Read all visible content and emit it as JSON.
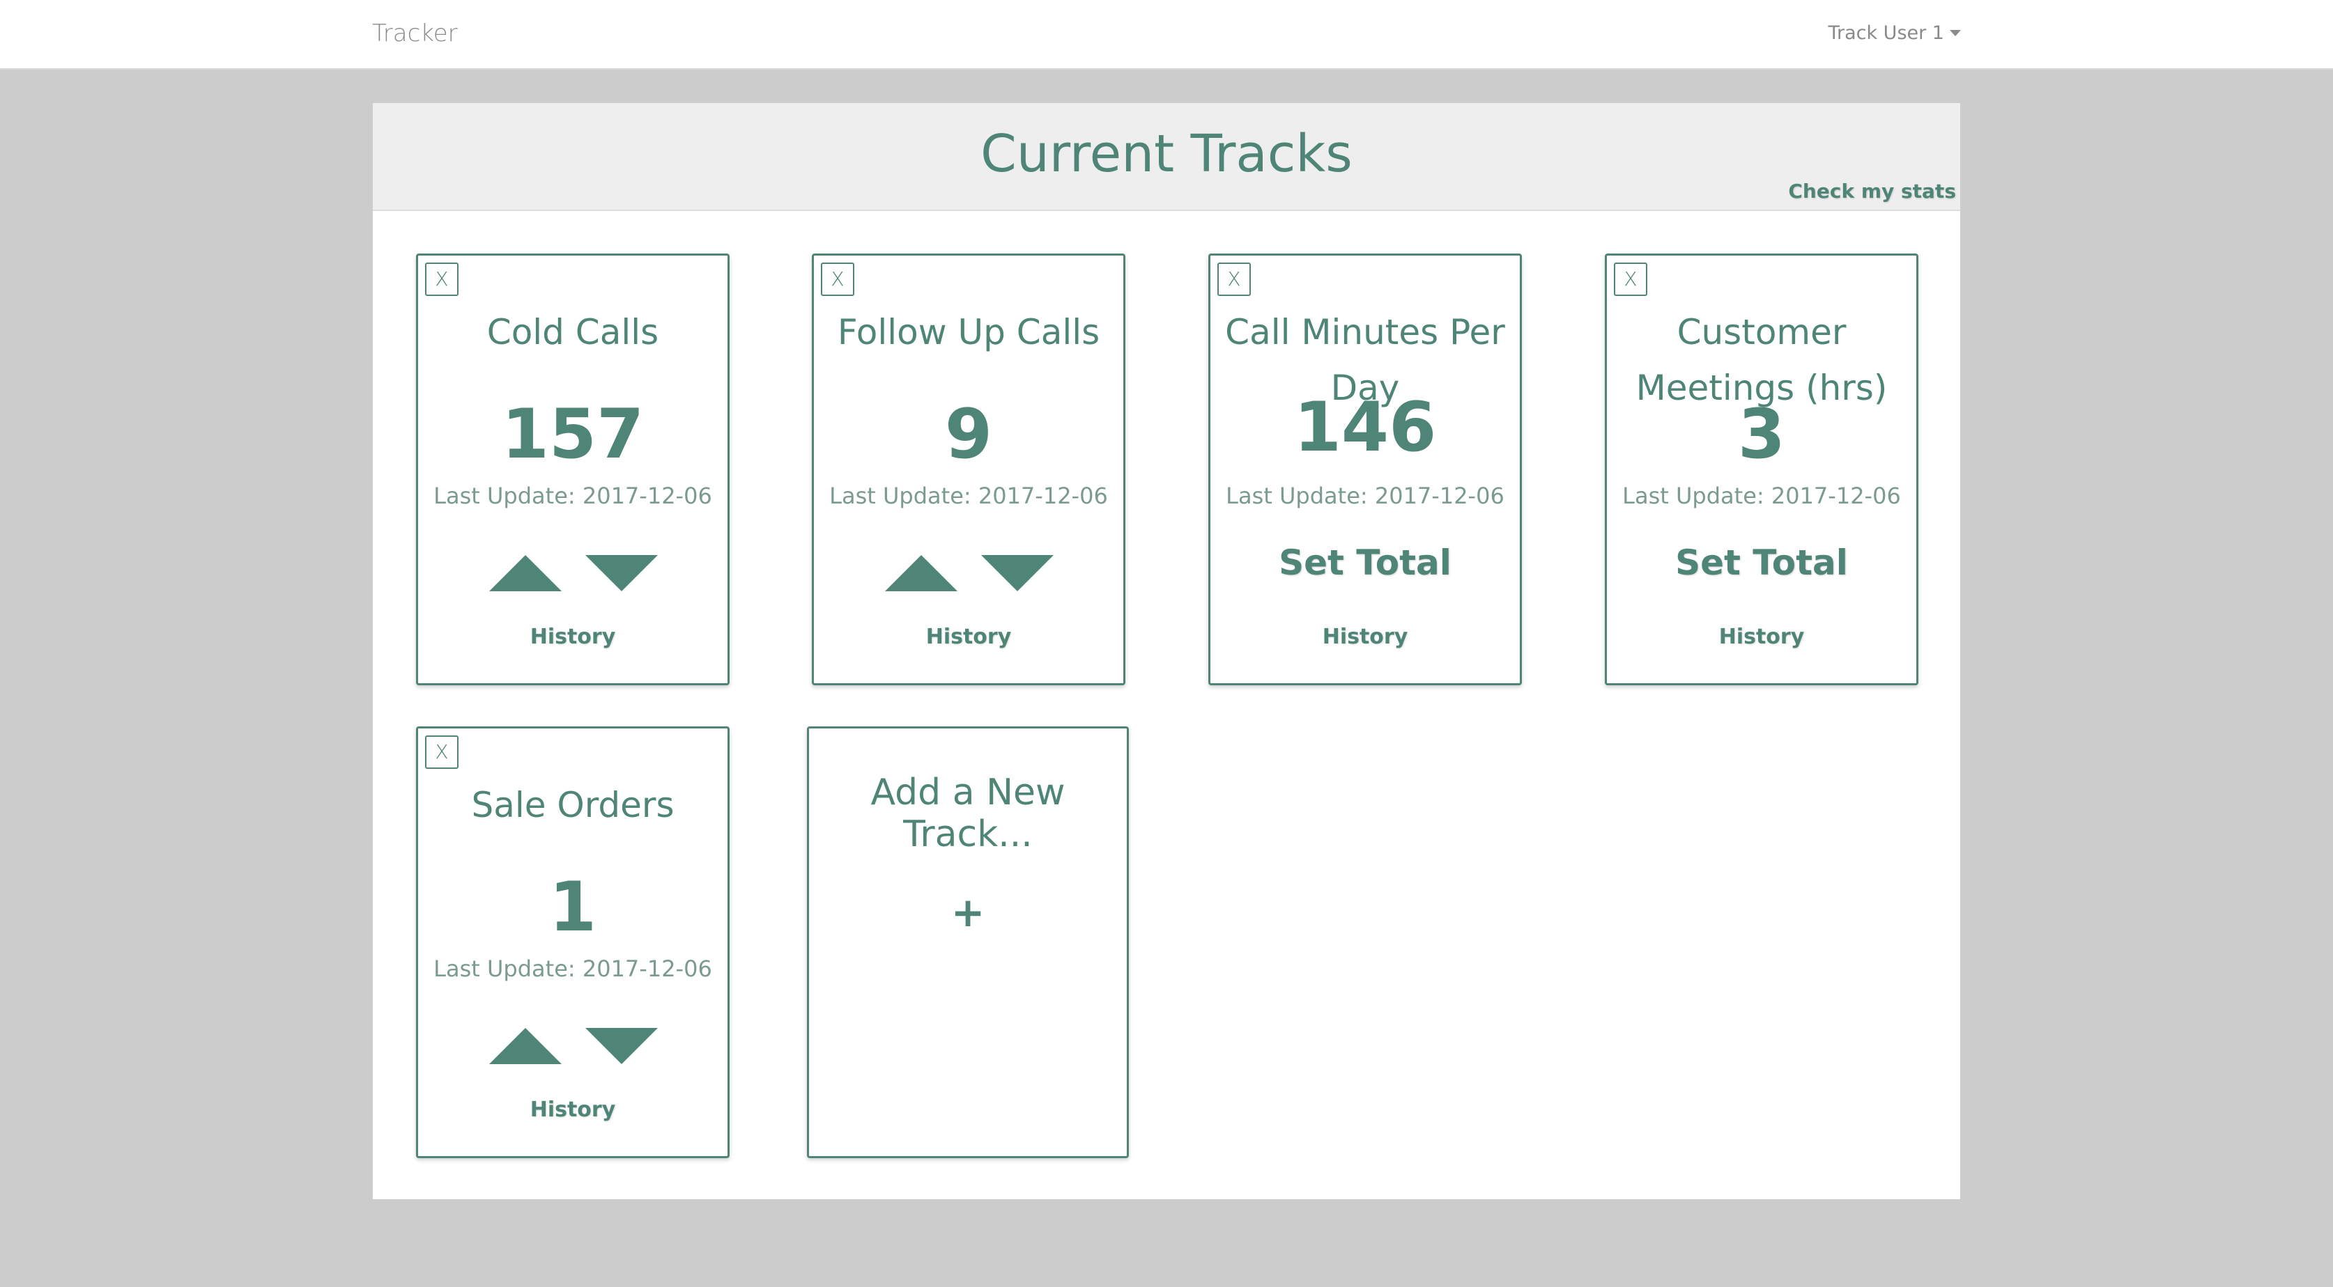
{
  "navbar": {
    "brand": "Tracker",
    "user_menu_label": "Track User 1"
  },
  "panel": {
    "title": "Current Tracks",
    "stats_link": "Check my stats"
  },
  "cards": [
    {
      "close": "X",
      "title": "Cold Calls",
      "value": "157",
      "last_update": "Last Update: 2017-12-06",
      "history": "History"
    },
    {
      "close": "X",
      "title": "Follow Up Calls",
      "value": "9",
      "last_update": "Last Update: 2017-12-06",
      "history": "History"
    },
    {
      "close": "X",
      "title": "Call Minutes Per Day",
      "value": "146",
      "last_update": "Last Update: 2017-12-06",
      "set_total": "Set Total",
      "history": "History"
    },
    {
      "close": "X",
      "title": "Customer Meetings (hrs)",
      "value": "3",
      "last_update": "Last Update: 2017-12-06",
      "set_total": "Set Total",
      "history": "History"
    },
    {
      "close": "X",
      "title": "Sale Orders",
      "value": "1",
      "last_update": "Last Update: 2017-12-06",
      "history": "History"
    }
  ],
  "add_card": {
    "title": "Add a New Track...",
    "plus": "+"
  },
  "colors": {
    "accent": "#4e8576",
    "background": "#cccccc",
    "header_bg": "#eeeeee"
  }
}
